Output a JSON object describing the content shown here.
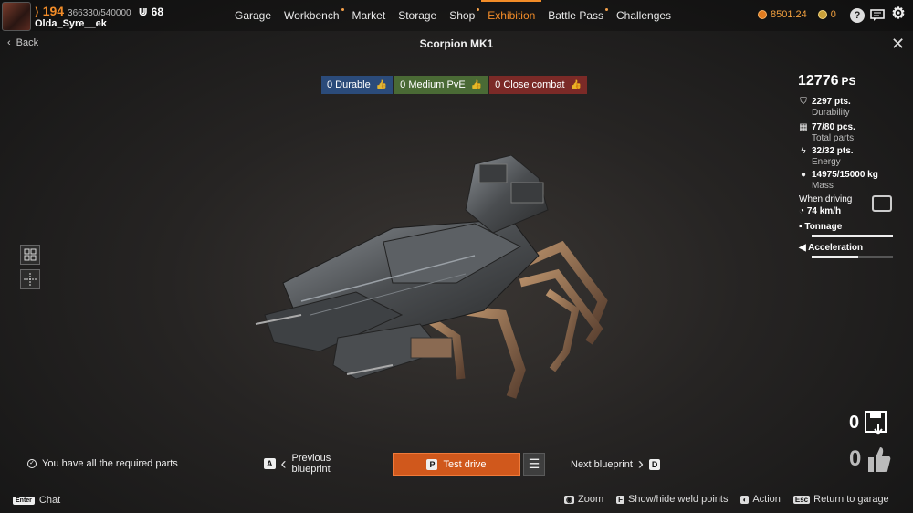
{
  "player": {
    "level": "194",
    "xp": "366330/540000",
    "engineers": "68",
    "name": "Olda_Syre__ek"
  },
  "nav": [
    {
      "label": "Garage",
      "dot": false,
      "active": false
    },
    {
      "label": "Workbench",
      "dot": true,
      "active": false
    },
    {
      "label": "Market",
      "dot": false,
      "active": false
    },
    {
      "label": "Storage",
      "dot": false,
      "active": false
    },
    {
      "label": "Shop",
      "dot": true,
      "active": false
    },
    {
      "label": "Exhibition",
      "dot": false,
      "active": true
    },
    {
      "label": "Battle Pass",
      "dot": true,
      "active": false
    },
    {
      "label": "Challenges",
      "dot": false,
      "active": false
    }
  ],
  "currency": {
    "coins": "8501.24",
    "badges": "0"
  },
  "header": {
    "back": "Back",
    "title": "Scorpion MK1"
  },
  "tags": [
    {
      "label": "0 Durable",
      "kind": "durable"
    },
    {
      "label": "0 Medium PvE",
      "kind": "pve"
    },
    {
      "label": "0 Close combat",
      "kind": "close"
    }
  ],
  "stats": {
    "ps": "12776",
    "ps_unit": "PS",
    "durability": {
      "value": "2297 pts.",
      "label": "Durability"
    },
    "parts": {
      "value": "77/80 pcs.",
      "label": "Total parts"
    },
    "energy": {
      "value": "32/32 pts.",
      "label": "Energy"
    },
    "mass": {
      "value": "14975/15000 kg",
      "label": "Mass"
    },
    "when_driving": "When driving",
    "speed": "74 km/h",
    "tonnage": {
      "label": "Tonnage",
      "level": 1.0
    },
    "acceleration": {
      "label": "Acceleration",
      "level": 0.57
    }
  },
  "bottom": {
    "required": "You have all the required parts",
    "prev_key": "A",
    "prev_line1": "Previous",
    "prev_line2": "blueprint",
    "test_key": "P",
    "test_drive": "Test drive",
    "next_label": "Next blueprint",
    "next_key": "D",
    "saves": "0",
    "likes": "0",
    "chat_key": "Enter",
    "chat": "Chat"
  },
  "hints": [
    {
      "key": "◉",
      "label": "Zoom"
    },
    {
      "key": "F",
      "label": "Show/hide weld points"
    },
    {
      "key": "◐",
      "label": "Action"
    },
    {
      "key": "Esc",
      "label": "Return to garage"
    }
  ],
  "colors": {
    "accent": "#f28c28",
    "durable": "#2b4b7a",
    "pve": "#4a6a35",
    "close": "#7b2a27",
    "test_drive": "#d0581c"
  }
}
